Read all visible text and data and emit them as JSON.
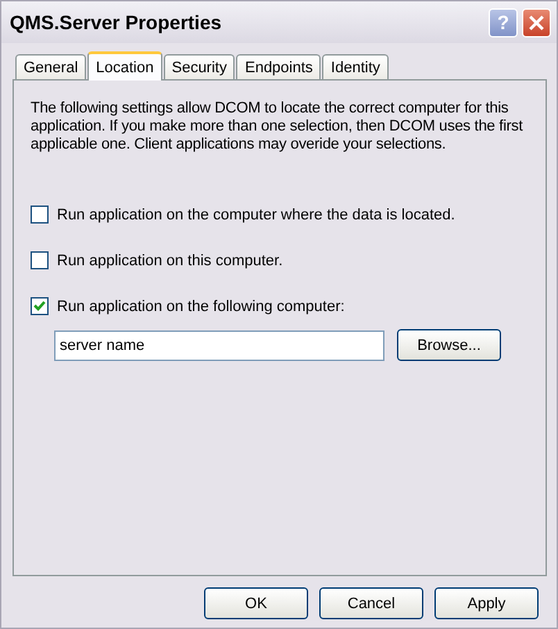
{
  "window": {
    "title": "QMS.Server Properties"
  },
  "title_buttons": [
    {
      "kind": "help",
      "label": "?"
    },
    {
      "kind": "close"
    }
  ],
  "tabs": [
    {
      "label": "General",
      "selected": false
    },
    {
      "label": "Location",
      "selected": true
    },
    {
      "label": "Security",
      "selected": false
    },
    {
      "label": "Endpoints",
      "selected": false
    },
    {
      "label": "Identity",
      "selected": false
    }
  ],
  "description": "The following settings allow DCOM to locate the correct computer for this application. If you make more than one selection, then DCOM uses the first applicable one. Client applications may overide your selections.",
  "options": [
    {
      "label": "Run application on the computer where the data is located.",
      "checked": false
    },
    {
      "label": "Run application on this computer.",
      "checked": false
    },
    {
      "label": "Run application on the following computer:",
      "checked": true
    }
  ],
  "computer_field": {
    "value": "server name"
  },
  "browse_button": "Browse...",
  "buttons": [
    "OK",
    "Cancel",
    "Apply"
  ]
}
